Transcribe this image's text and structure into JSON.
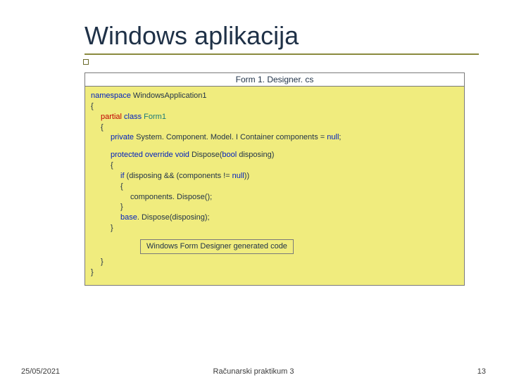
{
  "title": "Windows aplikacija",
  "file_header": "Form 1. Designer. cs",
  "code": {
    "ns_kw": "namespace",
    "ns_name": " WindowsApplication1",
    "brace_open": "{",
    "partial_kw": "partial",
    "class_kw": " class ",
    "class_name": "Form1",
    "private_kw": "private",
    "comp_type": " System. Component. Model. I Container ",
    "comp_name": "components = ",
    "null_kw": "null",
    "semicolon": ";",
    "protected_kw": "protected",
    "override_kw": " override ",
    "void_kw": "void",
    "dispose_sig_a": " Dispose(",
    "bool_kw": "bool",
    "dispose_sig_b": " disposing)",
    "if_kw": "if",
    "if_cond": " (disposing && (components != ",
    "if_cond_end": "))",
    "dispose_call": "components. Dispose();",
    "base_kw": "base",
    "base_call": ". Dispose(disposing);",
    "brace_close": "}"
  },
  "designer_region": "Windows Form Designer generated code",
  "footer": {
    "date": "25/05/2021",
    "center": "Računarski praktikum 3",
    "page": "13"
  }
}
